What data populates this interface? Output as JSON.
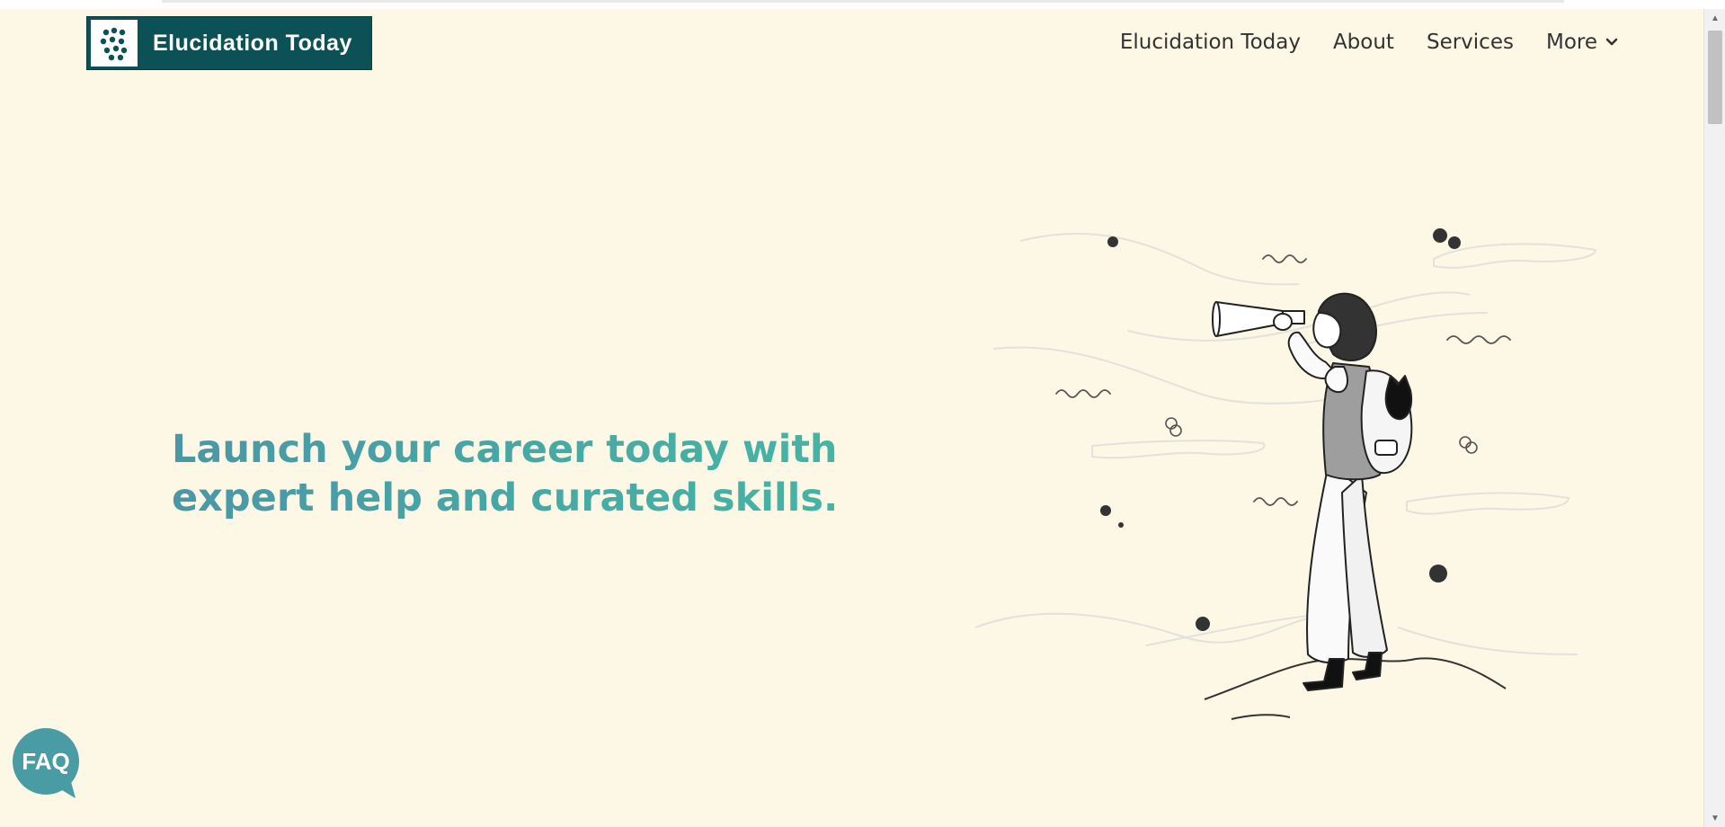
{
  "logo": {
    "text": "Elucidation Today",
    "icon": "dots-logo-icon"
  },
  "nav": {
    "items": [
      {
        "label": "Elucidation Today"
      },
      {
        "label": "About"
      },
      {
        "label": "Services"
      },
      {
        "label": "More",
        "icon": "chevron-down-icon"
      }
    ]
  },
  "hero": {
    "line1": "Launch your career today with",
    "line2": "expert help and curated skills.",
    "illustration": "person-with-telescope-illustration"
  },
  "faq": {
    "label": "FAQ"
  },
  "colors": {
    "brand": "#0b5156",
    "background": "#fdf7e6",
    "accent": "#4a9ca4",
    "faq": "#4a9ca4"
  }
}
